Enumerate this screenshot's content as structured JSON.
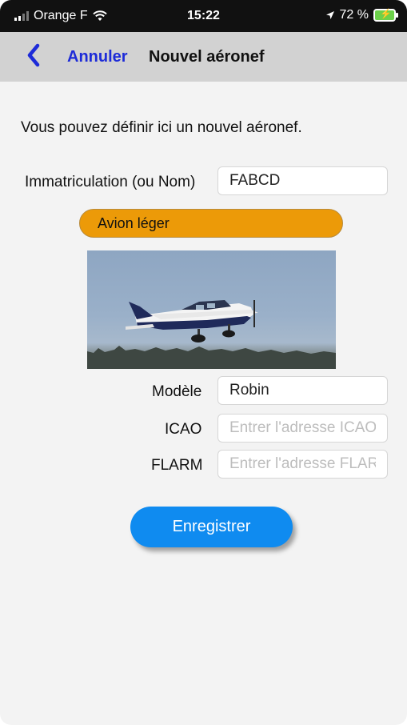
{
  "status_bar": {
    "carrier": "Orange F",
    "time": "15:22",
    "battery": "72 %"
  },
  "nav": {
    "back_icon": "chevron-left-icon",
    "cancel_label": "Annuler",
    "title": "Nouvel aéronef"
  },
  "form": {
    "intro": "Vous pouvez définir ici un nouvel aéronef.",
    "registration": {
      "label": "Immatriculation (ou Nom)",
      "value": "FABCD"
    },
    "aircraft_type": "Avion léger",
    "model": {
      "label": "Modèle",
      "value": "Robin"
    },
    "icao": {
      "label": "ICAO",
      "placeholder": "Entrer l'adresse ICAO"
    },
    "flarm": {
      "label": "FLARM",
      "placeholder": "Entrer l'adresse FLARM"
    },
    "save_label": "Enregistrer"
  },
  "colors": {
    "accent_blue": "#0f8bf0",
    "nav_link": "#1d2bd8",
    "type_pill": "#ec9a08"
  }
}
